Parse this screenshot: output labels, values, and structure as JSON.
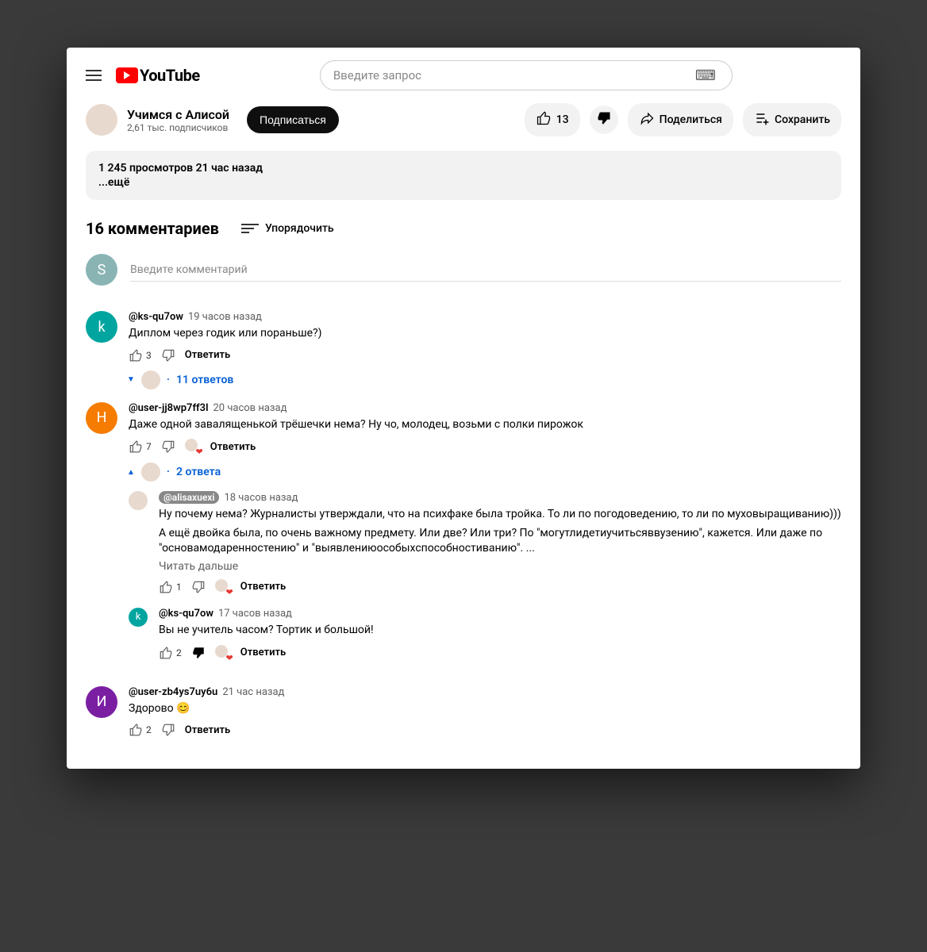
{
  "header": {
    "brand": "YouTube",
    "search_placeholder": "Введите запрос"
  },
  "channel": {
    "name": "Учимся с Алисой",
    "subscribers": "2,61 тыс. подписчиков",
    "subscribe_label": "Подписаться"
  },
  "actions": {
    "like_count": "13",
    "share": "Поделиться",
    "save": "Сохранить"
  },
  "meta": {
    "line": "1 245 просмотров  21 час назад",
    "more": "...ещё"
  },
  "comments": {
    "count_label": "16 комментариев",
    "sort_label": "Упорядочить",
    "add_placeholder": "Введите комментарий",
    "user_initial": "S"
  },
  "reply_label": "Ответить",
  "c1": {
    "author": "@ks-qu7ow",
    "time": "19 часов назад",
    "text": "Диплом через годик или пораньше?)",
    "likes": "3",
    "replies_label": "11 ответов",
    "initial": "k"
  },
  "c2": {
    "author": "@user-jj8wp7ff3l",
    "time": "20 часов назад",
    "text": "Даже одной завалященькой трёшечки нема? Ну чо, молодец, возьми с полки пирожок",
    "likes": "7",
    "replies_label": "2 ответа",
    "initial": "Н"
  },
  "c2r1": {
    "author": "@alisaxuexi",
    "time": "18 часов назад",
    "text1": "Ну почему нема? Журналисты утверждали, что на психфаке была тройка. То ли по погодоведению, то ли по муховыращиванию)))",
    "text2": "А ещё двойка была, по очень важному предмету. Или две? Или три? По \"могутлидетиучитьсяввузению\", кажется. Или даже по \"основамодаренностению\" и \"выявлениюособыхспособностиванию\". ...",
    "read_more": "Читать дальше",
    "likes": "1"
  },
  "c2r2": {
    "author": "@ks-qu7ow",
    "time": "17 часов назад",
    "text": "Вы не учитель часом? Тортик и большой!",
    "likes": "2",
    "initial": "k"
  },
  "c3": {
    "author": "@user-zb4ys7uy6u",
    "time": "21 час назад",
    "text": "Здорово 😊",
    "likes": "2",
    "initial": "И"
  }
}
